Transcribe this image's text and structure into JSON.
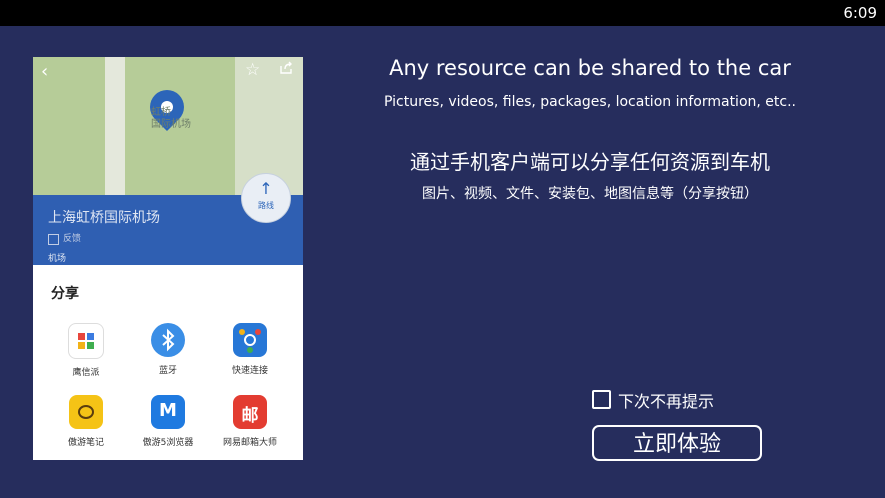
{
  "status_bar": {
    "time": "6:09"
  },
  "phone": {
    "map": {
      "place_label": "虹桥\n国际机场"
    },
    "route_button_label": "路线",
    "place_name": "上海虹桥国际机场",
    "feedback_label": "反馈",
    "category": "机场",
    "share_title": "分享",
    "apps": [
      {
        "label": "鹰信派",
        "icon": "yingxinpai-icon",
        "color": "#ffffff"
      },
      {
        "label": "蓝牙",
        "icon": "bluetooth-icon",
        "color": "#3a8ee6"
      },
      {
        "label": "快速连接",
        "icon": "quick-connect-icon",
        "color": "#2777d6"
      },
      {
        "label": "傲游笔记",
        "icon": "maxthon-notes-icon",
        "color": "#f5c316"
      },
      {
        "label": "傲游5浏览器",
        "icon": "maxthon-browser-icon",
        "color": "#1f7ae0"
      },
      {
        "label": "网易邮箱大师",
        "icon": "netease-mail-icon",
        "color": "#e33c31"
      }
    ]
  },
  "info": {
    "en_title": "Any resource  can be shared to the car",
    "en_sub": "Pictures, videos, files, packages, location information, etc..",
    "zh_title": "通过手机客户端可以分享任何资源到车机",
    "zh_sub": "图片、视频、文件、安装包、地图信息等（分享按钮）"
  },
  "dont_show_again": {
    "label": "下次不再提示",
    "checked": false
  },
  "try_now_button": {
    "label": "立即体验"
  },
  "colors": {
    "background": "#262d5d",
    "status_bar": "#000000",
    "phone_blue": "#2f5fb2"
  }
}
